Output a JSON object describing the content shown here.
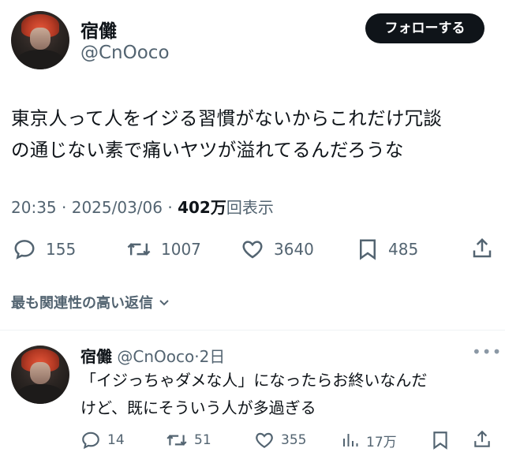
{
  "tweet": {
    "author_name": "宿儺",
    "author_handle": "@CnOoco",
    "follow_label": "フォローする",
    "text_line1": "東京人って人をイジる習慣がないからこれだけ冗談",
    "text_line2": "の通じない素で痛いヤツが溢れてるんだろうな",
    "time": "20:35",
    "sep1": " · ",
    "date": "2025/03/06",
    "sep2": " · ",
    "views_count": "402万",
    "views_label": "回表示",
    "actions": {
      "replies": "155",
      "retweets": "1007",
      "likes": "3640",
      "bookmarks": "485"
    },
    "icons": [
      "reply-icon",
      "retweet-icon",
      "like-icon",
      "bookmark-icon",
      "share-icon"
    ]
  },
  "relevant_replies_label": "最も関連性の高い返信",
  "reply": {
    "author_name": "宿儺",
    "author_handle": "@CnOoco",
    "sep": "·",
    "time": "2日",
    "more": "•••",
    "text_line1": "「イジっちゃダメな人」になったらお終いなんだ",
    "text_line2": "けど、既にそういう人が多過ぎる",
    "actions": {
      "replies": "14",
      "retweets": "51",
      "likes": "355",
      "views": "17万"
    },
    "icons": [
      "reply-icon",
      "retweet-icon",
      "like-icon",
      "views-icon",
      "bookmark-icon",
      "share-icon"
    ]
  },
  "colors": {
    "text": "#0f1419",
    "secondary": "#536471",
    "follow_bg": "#0f1419",
    "divider": "#eff3f4"
  }
}
